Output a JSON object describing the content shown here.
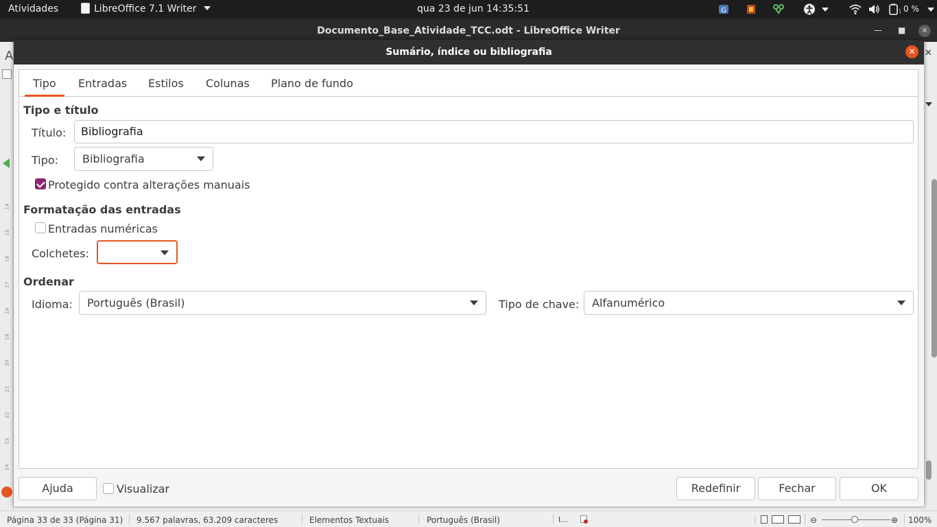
{
  "topbar": {
    "activities": "Atividades",
    "app_menu": "LibreOffice 7.1 Writer",
    "clock": "qua 23 de jun  14:35:51",
    "battery": "0 %"
  },
  "window": {
    "title": "Documento_Base_Atividade_TCC.odt - LibreOffice Writer"
  },
  "dialog": {
    "title": "Sumário, índice ou bibliografia",
    "tabs": [
      "Tipo",
      "Entradas",
      "Estilos",
      "Colunas",
      "Plano de fundo"
    ],
    "active_tab": "Tipo",
    "type_title": {
      "heading": "Tipo e título",
      "title_label": "Título:",
      "title_value": "Bibliografia",
      "type_label": "Tipo:",
      "type_value": "Bibliografia",
      "protected_label": "Protegido contra alterações manuais",
      "protected_checked": true
    },
    "formatting": {
      "heading": "Formatação das entradas",
      "numeric_label": "Entradas numéricas",
      "numeric_checked": false,
      "brackets_label": "Colchetes:",
      "brackets_value": ""
    },
    "sort": {
      "heading": "Ordenar",
      "language_label": "Idioma:",
      "language_value": "Português (Brasil)",
      "key_type_label": "Tipo de chave:",
      "key_type_value": "Alfanumérico"
    },
    "buttons": {
      "help": "Ajuda",
      "preview": "Visualizar",
      "reset": "Redefinir",
      "close": "Fechar",
      "ok": "OK"
    }
  },
  "statusbar": {
    "page": "Página 33 de 33 (Página 31)",
    "words": "9.567 palavras, 63.209 caracteres",
    "style": "Elementos Textuais",
    "language": "Português (Brasil)",
    "zoom": "100%"
  },
  "ruler_numbers": [
    "14",
    "15",
    "16",
    "17",
    "18",
    "19",
    "20",
    "21",
    "22",
    "23",
    "24"
  ],
  "colors": {
    "accent": "#e95420",
    "checkbox": "#8b2670",
    "titlebar": "#303030"
  }
}
